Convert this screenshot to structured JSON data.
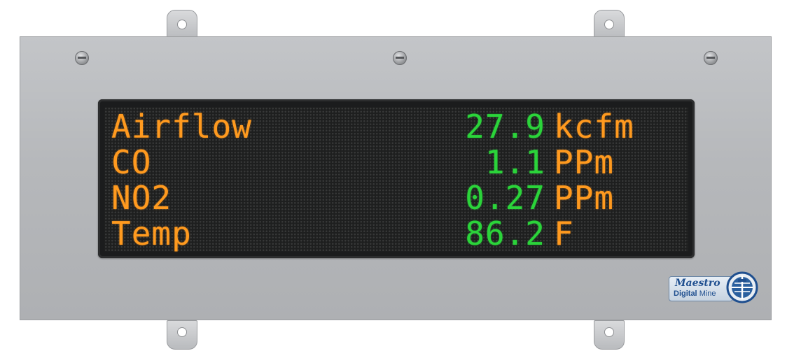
{
  "display": {
    "rows": [
      {
        "label": "Airflow",
        "value": "27.9",
        "unit": "kcfm"
      },
      {
        "label": "CO",
        "value": "1.1",
        "unit": "PPm"
      },
      {
        "label": "NO2",
        "value": "0.27",
        "unit": "PPm"
      },
      {
        "label": "Temp",
        "value": "86.2",
        "unit": "F"
      }
    ]
  },
  "logo": {
    "name": "Maestro",
    "sub_bold": "Digital",
    "sub_regular": "Mine"
  },
  "colors": {
    "label_amber": "#ff9a1f",
    "value_green": "#2bd43a",
    "plate": "#b6b8bb",
    "screen": "#1e1f1f"
  },
  "icons": [
    "mounting-tab",
    "screw-icon",
    "maestro-logo-icon"
  ]
}
